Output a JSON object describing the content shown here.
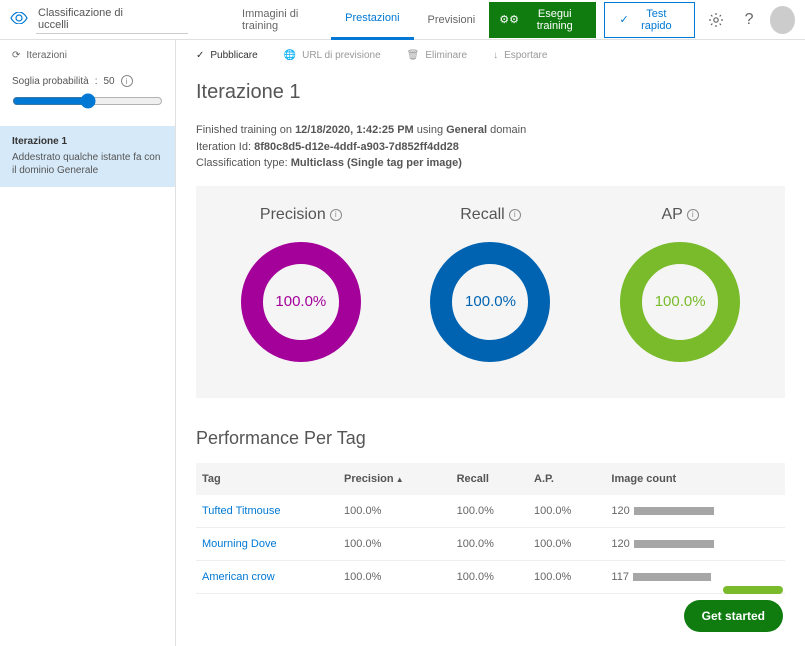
{
  "header": {
    "project_name": "Classificazione di uccelli",
    "tabs": [
      "Immagini di training",
      "Prestazioni",
      "Previsioni"
    ],
    "active_tab": 1,
    "train_btn": "Esegui training",
    "quick_btn": "Test rapido"
  },
  "sidebar": {
    "iterations_label": "Iterazioni",
    "threshold_label": "Soglia probabilità",
    "threshold_value": "50",
    "item": {
      "title": "Iterazione 1",
      "subtitle": "Addestrato qualche istante fa con il dominio Generale"
    }
  },
  "toolbar": {
    "publish": "Pubblicare",
    "url": "URL di previsione",
    "delete": "Eliminare",
    "export": "Esportare"
  },
  "page": {
    "title": "Iterazione 1",
    "finished_prefix": "Finished training on ",
    "finished_date": "12/18/2020, 1:42:25 PM",
    "finished_suffix": " using ",
    "domain": "General",
    "domain_suffix": " domain",
    "iter_id_label": "Iteration Id: ",
    "iter_id": "8f80c8d5-d12e-4ddf-a903-7d852ff4dd28",
    "class_label": "Classification type: ",
    "class_type": "Multiclass (Single tag per image)"
  },
  "metrics": {
    "precision_label": "Precision",
    "recall_label": "Recall",
    "ap_label": "AP",
    "precision": "100.0%",
    "recall": "100.0%",
    "ap": "100.0%"
  },
  "perf": {
    "title": "Performance Per Tag",
    "cols": {
      "tag": "Tag",
      "precision": "Precision",
      "recall": "Recall",
      "ap": "A.P.",
      "count": "Image count"
    },
    "rows": [
      {
        "tag": "Tufted Titmouse",
        "precision": "100.0%",
        "recall": "100.0%",
        "ap": "100.0%",
        "count": "120"
      },
      {
        "tag": "Mourning Dove",
        "precision": "100.0%",
        "recall": "100.0%",
        "ap": "100.0%",
        "count": "120"
      },
      {
        "tag": "American crow",
        "precision": "100.0%",
        "recall": "100.0%",
        "ap": "100.0%",
        "count": "117"
      }
    ]
  },
  "cta": "Get started",
  "chart_data": [
    {
      "type": "pie",
      "title": "Precision",
      "values": [
        100.0
      ],
      "categories": [
        "Precision"
      ],
      "ylim": [
        0,
        100
      ]
    },
    {
      "type": "pie",
      "title": "Recall",
      "values": [
        100.0
      ],
      "categories": [
        "Recall"
      ],
      "ylim": [
        0,
        100
      ]
    },
    {
      "type": "pie",
      "title": "AP",
      "values": [
        100.0
      ],
      "categories": [
        "AP"
      ],
      "ylim": [
        0,
        100
      ]
    },
    {
      "type": "bar",
      "title": "Image count",
      "categories": [
        "Tufted Titmouse",
        "Mourning Dove",
        "American crow"
      ],
      "values": [
        120,
        120,
        117
      ],
      "ylim": [
        0,
        120
      ]
    }
  ]
}
